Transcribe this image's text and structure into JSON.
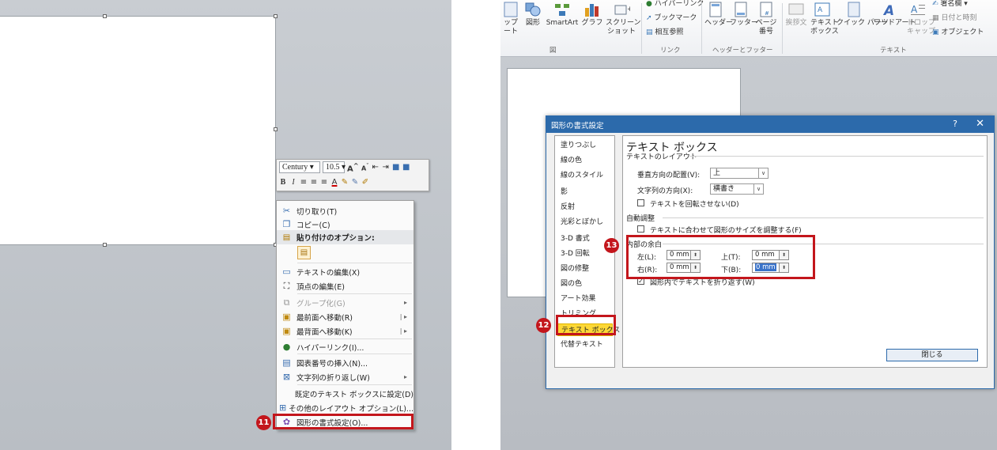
{
  "left": {
    "minibar": {
      "font_name": "Century",
      "font_size": "10.5"
    },
    "context_menu": {
      "items": [
        {
          "label": "切り取り(T)",
          "icon": "scissors-icon"
        },
        {
          "label": "コピー(C)",
          "icon": "copy-icon"
        },
        {
          "label": "貼り付けのオプション:",
          "icon": "paste-icon"
        },
        {
          "label": "テキストの編集(X)",
          "icon": "text-edit-icon"
        },
        {
          "label": "頂点の編集(E)",
          "icon": "edit-points-icon"
        },
        {
          "label": "グループ化(G)",
          "icon": "group-icon"
        },
        {
          "label": "最前面へ移動(R)",
          "icon": "bring-front-icon"
        },
        {
          "label": "最背面へ移動(K)",
          "icon": "send-back-icon"
        },
        {
          "label": "ハイパーリンク(I)...",
          "icon": "hyperlink-icon"
        },
        {
          "label": "図表番号の挿入(N)...",
          "icon": "caption-icon"
        },
        {
          "label": "文字列の折り返し(W)",
          "icon": "wrap-text-icon"
        },
        {
          "label": "既定のテキスト ボックスに設定(D)",
          "icon": ""
        },
        {
          "label": "その他のレイアウト オプション(L)...",
          "icon": "layout-icon"
        },
        {
          "label": "図形の書式設定(O)...",
          "icon": "format-shape-icon"
        }
      ]
    },
    "badge": "11"
  },
  "right": {
    "ribbon": {
      "items": [
        {
          "label": "ップ\nート",
          "icon": "clipart-icon"
        },
        {
          "label": "図形",
          "icon": "shapes-icon"
        },
        {
          "label": "SmartArt",
          "icon": "smartart-icon"
        },
        {
          "label": "グラフ",
          "icon": "chart-icon"
        },
        {
          "label": "スクリーン\nショット",
          "icon": "screenshot-icon"
        }
      ],
      "links": [
        "ハイパーリンク",
        "ブックマーク",
        "相互参照"
      ],
      "header_footer": [
        "ヘッダー",
        "フッター",
        "ページ\n番号"
      ],
      "text_items": [
        "挨拶文",
        "テキスト\nボックス",
        "クイック パーツ",
        "ワードアート",
        "ドロップ\nキャップ"
      ],
      "side_items": [
        "署名欄",
        "日付と時刻",
        "オブジェクト"
      ],
      "groups": {
        "illustrations": "図",
        "links": "リンク",
        "header_footer": "ヘッダーとフッター",
        "text": "テキスト"
      }
    },
    "dialog": {
      "title": "図形の書式設定",
      "help": "?",
      "close_x": "✕",
      "categories": [
        "塗りつぶし",
        "線の色",
        "線のスタイル",
        "影",
        "反射",
        "光彩とぼかし",
        "3-D 書式",
        "3-D 回転",
        "図の修整",
        "図の色",
        "アート効果",
        "トリミング",
        "テキスト ボックス",
        "代替テキスト"
      ],
      "panel_title": "テキスト ボックス",
      "layout_header": "テキストのレイアウト",
      "vertical_align_label": "垂直方向の配置(V):",
      "vertical_align_value": "上",
      "text_direction_label": "文字列の方向(X):",
      "text_direction_value": "横書き",
      "no_rotate_label": "テキストを回転させない(D)",
      "autofit_header": "自動調整",
      "autofit_label": "テキストに合わせて図形のサイズを調整する(F)",
      "margin_header": "内部の余白",
      "left_label": "左(L):",
      "left_value": "0 mm",
      "top_label": "上(T):",
      "top_value": "0 mm",
      "right_label": "右(R):",
      "right_value": "0 mm",
      "bottom_label": "下(B):",
      "bottom_value": "0 mm",
      "wrap_label": "図形内でテキストを折り返す(W)",
      "close_button": "閉じる"
    },
    "badges": [
      "12",
      "13"
    ]
  },
  "colors": {
    "red_highlight": "#c3161c",
    "dialog_blue": "#2c6aab",
    "selected_yellow": "#fdd835"
  }
}
